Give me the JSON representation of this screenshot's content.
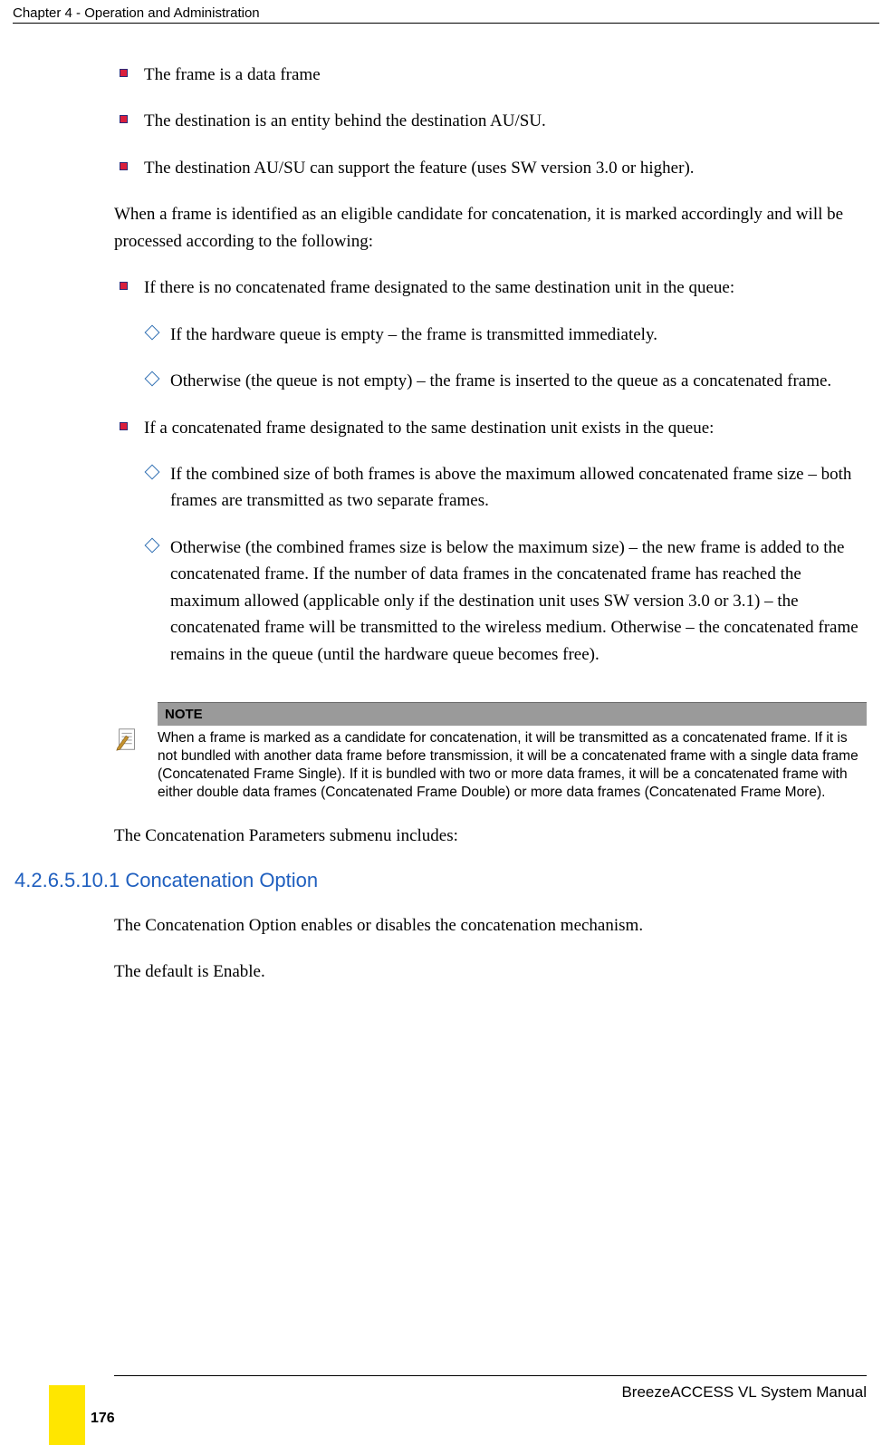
{
  "header": {
    "chapter": "Chapter 4 - Operation and Administration"
  },
  "bullets_top": [
    "The frame is a data frame",
    "The destination is an entity behind the destination AU/SU.",
    "The destination AU/SU can support the feature (uses SW version 3.0 or higher)."
  ],
  "para_when": "When a frame is identified as an eligible candidate for concatenation, it is marked accordingly and will be processed according to the following:",
  "bullet_noframe": "If there is no concatenated frame designated to the same destination unit in the queue:",
  "sub_no": [
    "If the hardware queue is empty – the frame is transmitted immediately.",
    "Otherwise (the queue is not empty) – the frame is inserted to the queue as a concatenated frame."
  ],
  "bullet_exists": "If a concatenated frame designated to the same destination unit exists in the queue:",
  "sub_ex": [
    "If the combined size of both frames is above the maximum allowed concatenated frame size – both frames are transmitted as two separate frames.",
    "Otherwise (the combined frames size is below the maximum size) – the new frame is added to the concatenated frame. If the number of data frames in the concatenated frame has reached the maximum allowed (applicable only if the destination unit uses SW version 3.0 or 3.1) – the concatenated frame will be transmitted to the wireless medium. Otherwise – the concatenated frame remains in the queue (until the hardware queue becomes free)."
  ],
  "note": {
    "title": "NOTE",
    "text": "When a frame is marked as a candidate for concatenation, it will be transmitted as a concatenated frame. If it is not bundled with another data frame before transmission, it will be a concatenated frame with a single data frame (Concatenated Frame Single). If it is bundled with two or more data frames, it will be a concatenated frame with either double data frames (Concatenated Frame Double) or more data frames (Concatenated Frame More)."
  },
  "para_submenu": "The Concatenation Parameters submenu includes:",
  "section": {
    "num_title": "4.2.6.5.10.1 Concatenation Option"
  },
  "para_option": "The Concatenation Option enables or disables the concatenation mechanism.",
  "para_default": "The default is Enable.",
  "footer": {
    "manual": "BreezeACCESS VL System Manual",
    "page": "176"
  }
}
